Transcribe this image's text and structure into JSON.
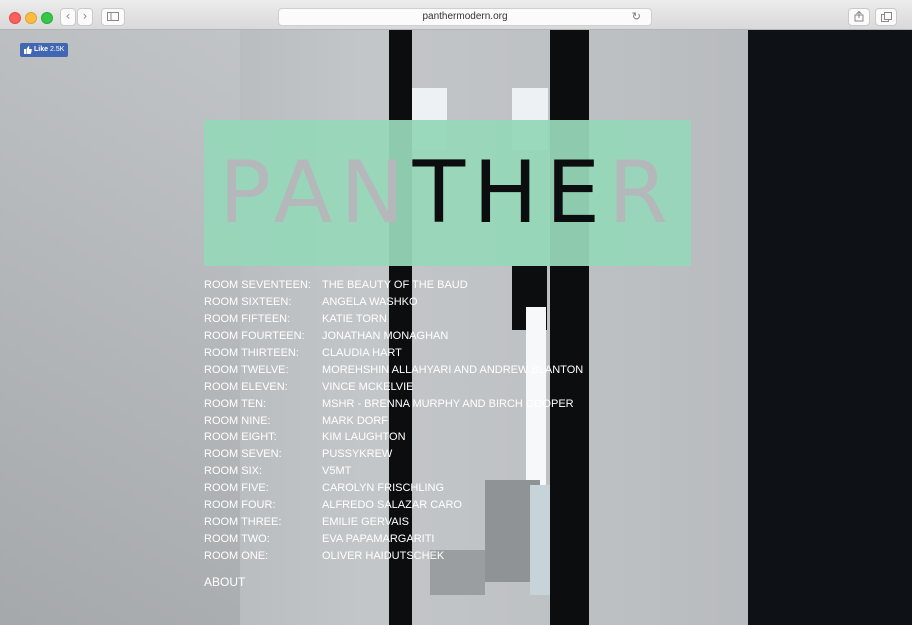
{
  "browser": {
    "url": "panthermodern.org",
    "nav": {
      "back_glyph": "‹",
      "forward_glyph": "›"
    },
    "icons": [
      "sidebar-icon",
      "reload-icon",
      "share-icon",
      "tabs-icon"
    ]
  },
  "like_button": {
    "label": "Like",
    "count": "2.5K"
  },
  "logo": {
    "part1": "PAN",
    "part2": "THE",
    "part3": "R"
  },
  "menu": {
    "items": [
      {
        "room": "ROOM SEVENTEEN:",
        "artist": "THE BEAUTY OF THE BAUD"
      },
      {
        "room": "ROOM SIXTEEN:",
        "artist": "ANGELA WASHKO"
      },
      {
        "room": "ROOM FIFTEEN:",
        "artist": "KATIE TORN"
      },
      {
        "room": "ROOM FOURTEEN:",
        "artist": "JONATHAN MONAGHAN"
      },
      {
        "room": "ROOM THIRTEEN:",
        "artist": "CLAUDIA HART"
      },
      {
        "room": "ROOM TWELVE:",
        "artist": "MOREHSHIN ALLAHYARI AND ANDREW BLANTON"
      },
      {
        "room": "ROOM ELEVEN:",
        "artist": "VINCE MCKELVIE"
      },
      {
        "room": "ROOM TEN:",
        "artist": "MSHR - BRENNA MURPHY AND BIRCH COOPER"
      },
      {
        "room": "ROOM NINE:",
        "artist": "MARK DORF"
      },
      {
        "room": "ROOM EIGHT:",
        "artist": "KIM LAUGHTON"
      },
      {
        "room": "ROOM SEVEN:",
        "artist": "PUSSYKREW"
      },
      {
        "room": "ROOM SIX:",
        "artist": "V5MT"
      },
      {
        "room": "ROOM FIVE:",
        "artist": "CAROLYN FRISCHLING"
      },
      {
        "room": "ROOM FOUR:",
        "artist": "ALFREDO SALAZAR CARO"
      },
      {
        "room": "ROOM THREE:",
        "artist": "EMILIE GERVAIS"
      },
      {
        "room": "ROOM TWO:",
        "artist": "EVA PAPAMARGARITI"
      },
      {
        "room": "ROOM ONE:",
        "artist": "OLIVER HAIDUTSCHEK"
      }
    ],
    "about": "ABOUT"
  },
  "colors": {
    "logo_bg": "#96d7b9",
    "like_bg": "#4267b2"
  }
}
